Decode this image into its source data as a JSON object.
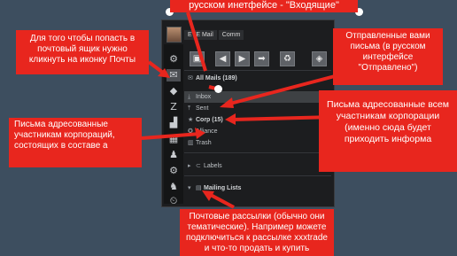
{
  "window": {
    "tabs": [
      "EVE Mail",
      "Comm"
    ],
    "toolbar_icons": [
      "compose-icon",
      "back-icon",
      "forward-icon",
      "refresh-icon",
      "tag-icon"
    ],
    "folders": [
      {
        "label": "All Mails  (189)",
        "icon": "mail-icon"
      },
      {
        "label": "Inbox",
        "icon": "inbox-icon"
      },
      {
        "label": "Sent",
        "icon": "sent-icon"
      },
      {
        "label": "Corp  (15)",
        "icon": "corp-icon"
      },
      {
        "label": "Alliance",
        "icon": "alliance-icon"
      },
      {
        "label": "Trash",
        "icon": "trash-icon"
      },
      {
        "label": "Labels",
        "icon": "labels-icon"
      },
      {
        "label": "Mailing Lists",
        "icon": "mailing-lists-icon"
      }
    ]
  },
  "notes": {
    "top": "русском инетфейсе - \"Входящие\"",
    "left_top": "Для того чтобы попасть в почтовый ящик нужно кликнуть на иконку Почты",
    "right_top": "Отправленные вами письма (в русском интерфейсе \"Отправлено\")",
    "right_mid": "Письма адресованные всем участникам корпорации (именно сюда будет приходить информа",
    "left_mid": "Письма адресованные участникам корпораций, состоящих в составе а",
    "bottom": "Почтовые рассылки (обычно  они тематические). Например можете подключиться к рассылке xxxtrade и что-то продать и купить"
  }
}
